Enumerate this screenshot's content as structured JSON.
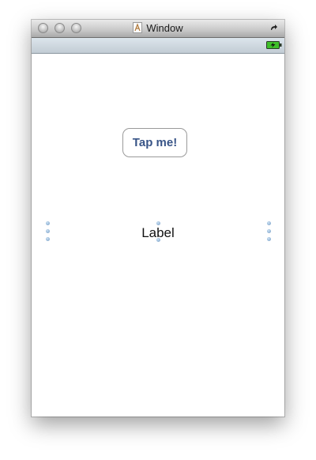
{
  "window": {
    "title": "Window",
    "title_icon": "document-icon",
    "controls": [
      "close-button",
      "minimize-button",
      "zoom-button"
    ],
    "toolbar_toggle_icon": "toolbar-toggle-icon"
  },
  "status_bar": {
    "battery_icon": "battery-charging-icon",
    "battery_color": "#3fbf2a"
  },
  "content": {
    "button_label": "Tap me!",
    "label_text": "Label",
    "selection_handle_color": "#6f99c2"
  }
}
